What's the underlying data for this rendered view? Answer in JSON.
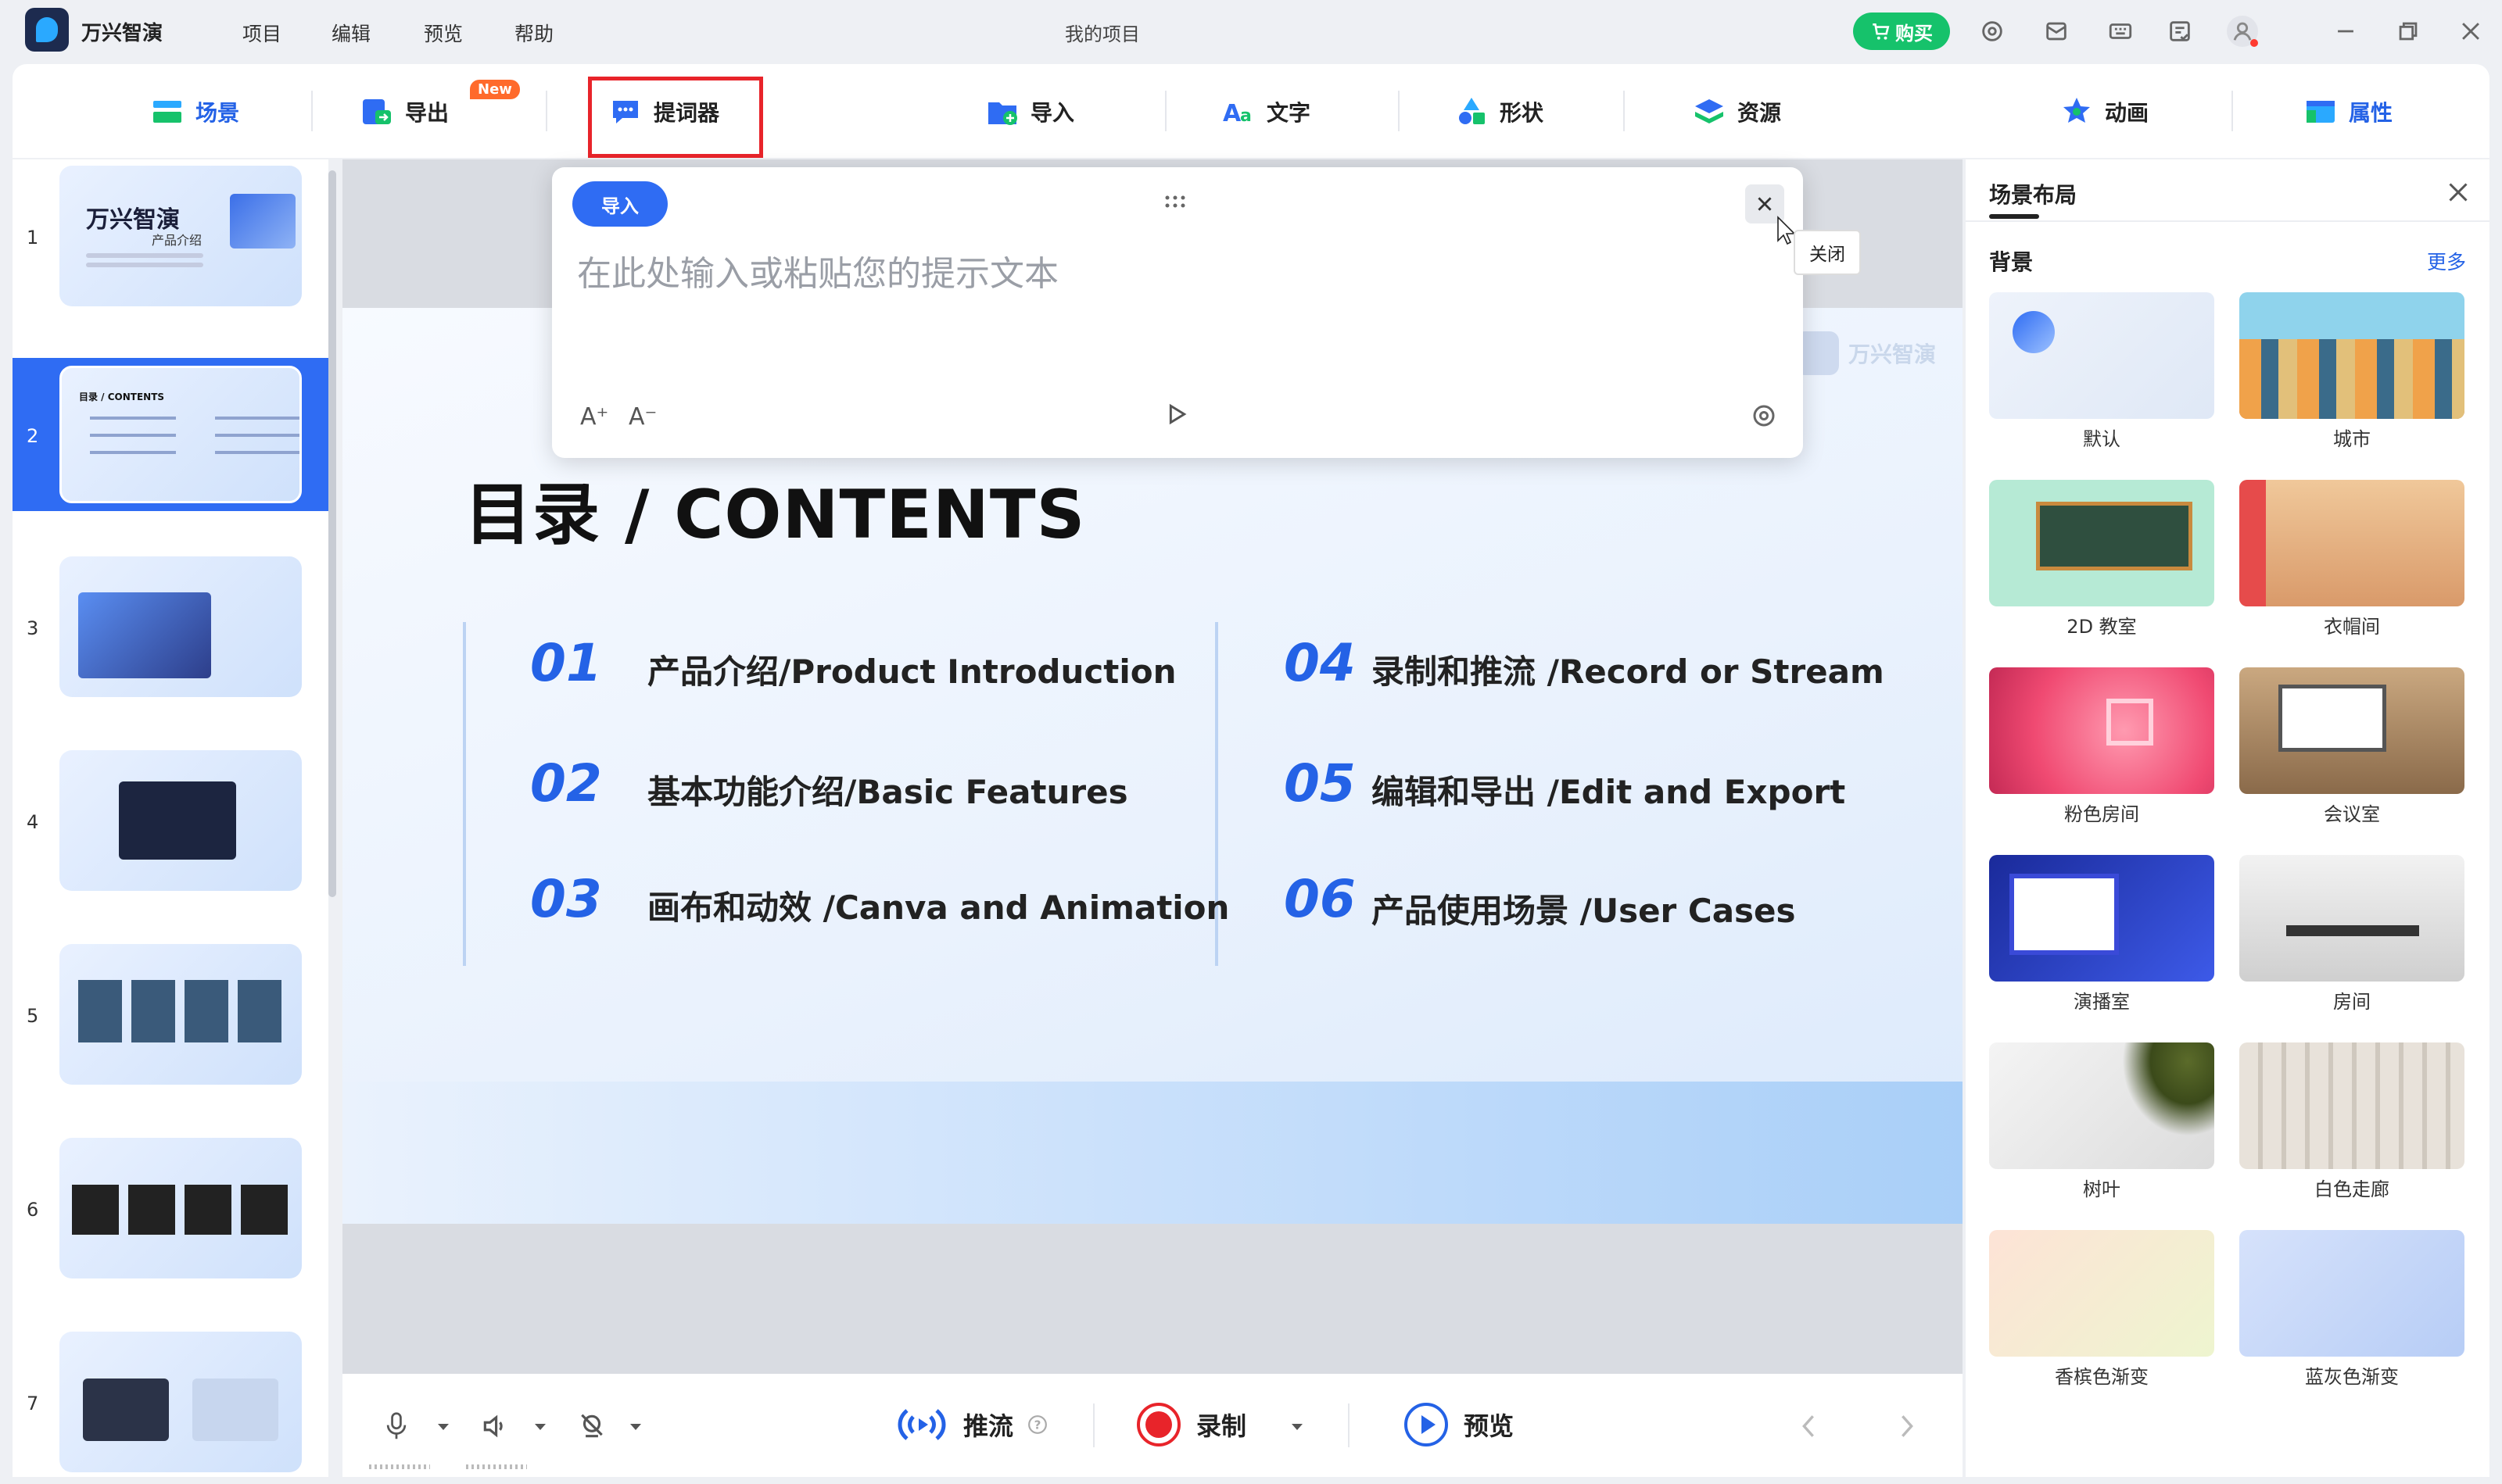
{
  "titlebar": {
    "app_name": "万兴智演",
    "menu": [
      "项目",
      "编辑",
      "预览",
      "帮助"
    ],
    "window_title": "我的项目",
    "buy_label": "购买"
  },
  "toolbar": {
    "scene": "场景",
    "export": "导出",
    "export_badge": "New",
    "prompter": "提词器",
    "import": "导入",
    "text": "文字",
    "shape": "形状",
    "resource": "资源",
    "animation": "动画",
    "properties": "属性"
  },
  "slides": {
    "numbers": [
      "1",
      "2",
      "3",
      "4",
      "5",
      "6",
      "7"
    ],
    "thumb1_title": "万兴智演",
    "thumb1_sub": "产品介绍",
    "thumb2_title": "目录 / CONTENTS",
    "active_index": 2
  },
  "canvas": {
    "brand": "万兴智演",
    "heading": "目录 / CONTENTS",
    "toc": [
      {
        "num": "01",
        "text": "产品介绍/Product Introduction"
      },
      {
        "num": "02",
        "text": "基本功能介绍/Basic Features"
      },
      {
        "num": "03",
        "text": "画布和动效 /Canva and Animation"
      },
      {
        "num": "04",
        "text": "录制和推流 /Record or Stream"
      },
      {
        "num": "05",
        "text": "编辑和导出 /Edit and Export"
      },
      {
        "num": "06",
        "text": "产品使用场景 /User Cases"
      }
    ]
  },
  "prompter": {
    "import_label": "导入",
    "placeholder": "在此处输入或粘贴您的提示文本",
    "font_up": "A⁺",
    "font_down": "A⁻",
    "close_tooltip": "关闭"
  },
  "bottombar": {
    "stream": "推流",
    "record": "录制",
    "preview": "预览"
  },
  "rightpanel": {
    "title": "场景布局",
    "section": "背景",
    "more": "更多",
    "backgrounds": [
      "默认",
      "城市",
      "2D 教室",
      "衣帽间",
      "粉色房间",
      "会议室",
      "演播室",
      "房间",
      "树叶",
      "白色走廊",
      "香槟色渐变",
      "蓝灰色渐变"
    ]
  },
  "colors": {
    "accent": "#2462e6",
    "buy_green": "#16c26b",
    "record_red": "#e8242a",
    "badge_orange": "#ff6a2b"
  }
}
